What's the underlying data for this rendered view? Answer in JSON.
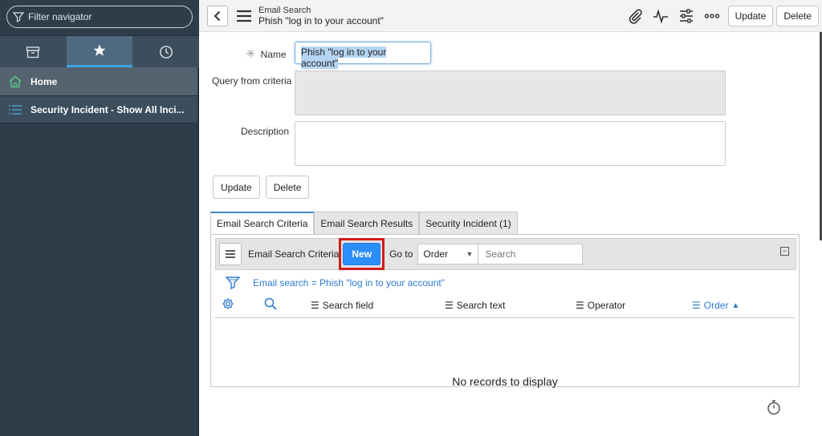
{
  "sidebar": {
    "filter_placeholder": "Filter navigator",
    "tabs": [
      {
        "icon": "archive-icon"
      },
      {
        "icon": "star-icon",
        "active": true
      },
      {
        "icon": "clock-icon"
      }
    ],
    "items": [
      {
        "label": "Home",
        "icon": "home-icon"
      },
      {
        "label": "Security Incident - Show All Inci...",
        "icon": "list-icon"
      }
    ]
  },
  "header": {
    "title": "Email Search",
    "subtitle": "Phish \"log in to your account\"",
    "update_label": "Update",
    "delete_label": "Delete",
    "icons": [
      "paperclip-icon",
      "activity-icon",
      "sliders-icon",
      "more-icon"
    ]
  },
  "form": {
    "name_label": "Name",
    "name_value": "Phish \"log in to your account\"",
    "query_label": "Query from criteria",
    "query_value": "",
    "description_label": "Description",
    "description_value": "",
    "update_label": "Update",
    "delete_label": "Delete"
  },
  "related": {
    "tabs": [
      {
        "label": "Email Search Criteria",
        "active": true
      },
      {
        "label": "Email Search Results"
      },
      {
        "label": "Security Incident (1)"
      }
    ],
    "list_title": "Email Search Criteria",
    "new_label": "New",
    "goto_label": "Go to",
    "goto_selected": "Order",
    "search_placeholder": "Search",
    "filter_text": "Email search = Phish \"log in to your account\"",
    "columns": [
      "Search field",
      "Search text",
      "Operator",
      "Order"
    ],
    "sort_indicator": "▲",
    "empty_text": "No records to display"
  },
  "colors": {
    "sidebar_bg": "#2e3d49",
    "accent_blue": "#2c8ef8",
    "link_blue": "#2f7ad0",
    "highlight_red": "#d01c1c"
  }
}
